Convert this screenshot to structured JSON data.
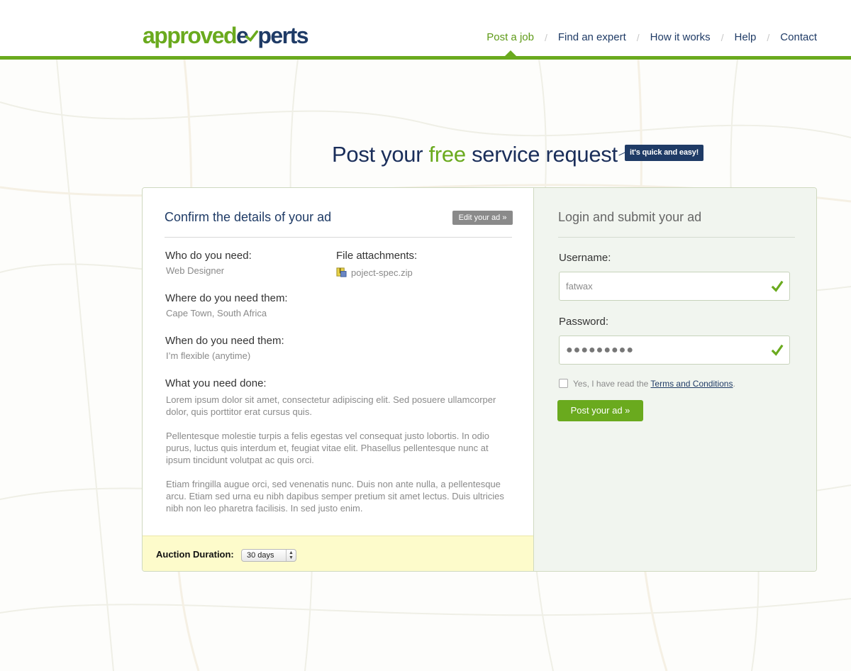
{
  "logo": {
    "part1": "approved",
    "part2": "e",
    "part3": "perts"
  },
  "nav": {
    "items": [
      {
        "label": "Post a job"
      },
      {
        "label": "Find an expert"
      },
      {
        "label": "How it works"
      },
      {
        "label": "Help"
      },
      {
        "label": "Contact"
      }
    ],
    "separator": "/"
  },
  "hero": {
    "title_pre": "Post your ",
    "title_free": "free",
    "title_post": " service request",
    "badge": "it's quick and easy!"
  },
  "confirm": {
    "title": "Confirm the details of your ad",
    "edit_label": "Edit your ad »",
    "who_label": "Who do you need:",
    "who_value": "Web Designer",
    "files_label": "File attachments:",
    "file_name": "poject-spec.zip",
    "where_label": "Where do you need them:",
    "where_value": "Cape Town, South Africa",
    "when_label": "When do you need them:",
    "when_value": "I’m flexible (anytime)",
    "what_label": "What you need done:",
    "paragraphs": [
      "Lorem ipsum dolor sit amet, consectetur adipiscing elit. Sed posuere ullamcorper dolor, quis porttitor erat cursus quis.",
      "Pellentesque molestie turpis a felis egestas vel consequat justo lobortis. In odio purus, luctus quis interdum et, feugiat vitae elit. Phasellus pellentesque nunc at ipsum tincidunt volutpat ac quis orci.",
      "Etiam fringilla augue orci, sed venenatis nunc. Duis non ante nulla, a pellentesque arcu. Etiam sed urna eu nibh dapibus semper pretium sit amet lectus. Duis ultricies nibh non leo pharetra facilisis. In sed justo enim."
    ],
    "auction_label": "Auction Duration:",
    "auction_value": "30 days"
  },
  "login": {
    "title": "Login and submit your ad",
    "username_label": "Username:",
    "username_value": "fatwax",
    "password_label": "Password:",
    "password_value": "●●●●●●●●●",
    "agree_text": "Yes, I have read the ",
    "tos_link": "Terms and Conditions",
    "agree_end": ".",
    "submit_label": "Post your ad »"
  },
  "colors": {
    "brand_green": "#6aaa1e",
    "brand_navy": "#1f3b66"
  },
  "icons": [
    "check-icon",
    "zip-file-icon",
    "select-arrows-icon"
  ]
}
